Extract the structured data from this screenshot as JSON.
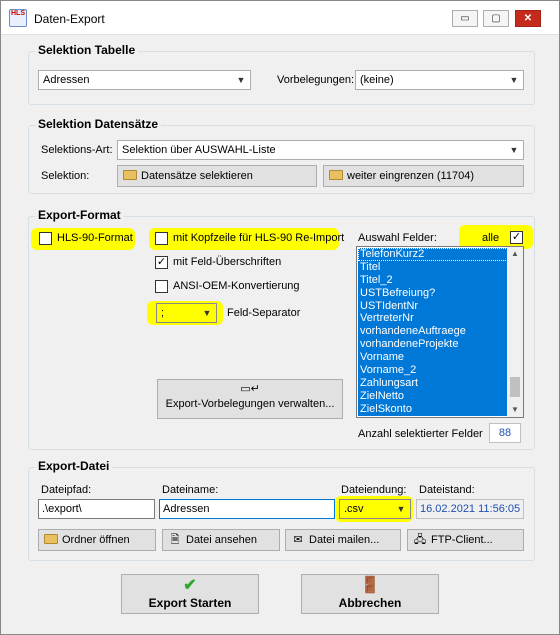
{
  "window": {
    "app_icon_text": "HLS",
    "title": "Daten-Export",
    "minimize": "▭",
    "maximize": "▢",
    "close": "✕"
  },
  "selektion_tabelle": {
    "title": "Selektion Tabelle",
    "table_value": "Adressen",
    "vorbelegungen_label": "Vorbelegungen:",
    "vorbelegungen_value": "(keine)"
  },
  "selektion_datensaetze": {
    "title": "Selektion Datensätze",
    "art_label": "Selektions-Art:",
    "art_value": "Selektion über AUSWAHL-Liste",
    "selektion_label": "Selektion:",
    "select_button": "Datensätze selektieren",
    "restrict_button": "weiter eingrenzen (11704)"
  },
  "export_format": {
    "title": "Export-Format",
    "hls90_label": "HLS-90-Format",
    "hls90_checked": false,
    "kopfzeile_label": "mit Kopfzeile für HLS-90 Re-Import",
    "kopfzeile_checked": false,
    "ueberschriften_label": "mit Feld-Überschriften",
    "ueberschriften_checked": true,
    "ansi_label": "ANSI-OEM-Konvertierung",
    "ansi_checked": false,
    "separator_value": ";",
    "separator_label": "Feld-Separator",
    "vorbelegungen_button": "Export-Vorbelegungen verwalten...",
    "auswahl_label": "Auswahl Felder:",
    "alle_label": "alle",
    "alle_checked": true,
    "fields": [
      "TelefonKurz2",
      "Titel",
      "Titel_2",
      "USTBefreiung?",
      "USTIdentNr",
      "VertreterNr",
      "vorhandeneAuftraege",
      "vorhandeneProjekte",
      "Vorname",
      "Vorname_2",
      "Zahlungsart",
      "ZielNetto",
      "ZielSkonto"
    ],
    "anzahl_label": "Anzahl selektierter Felder",
    "anzahl_value": "88"
  },
  "export_datei": {
    "title": "Export-Datei",
    "pfad_label": "Dateipfad:",
    "pfad_value": ".\\export\\",
    "name_label": "Dateiname:",
    "name_value": "Adressen",
    "endung_label": "Dateiendung:",
    "endung_value": ".csv",
    "stand_label": "Dateistand:",
    "stand_value": "16.02.2021 11:56:05",
    "ordner_button": "Ordner öffnen",
    "ansehen_button": "Datei ansehen",
    "mailen_button": "Datei mailen...",
    "ftp_button": "FTP-Client..."
  },
  "actions": {
    "start_label": "Export Starten",
    "start_icon": "✔",
    "cancel_label": "Abbrechen",
    "cancel_icon": "🚪"
  },
  "colors": {
    "highlight": "#ffff00",
    "selection": "#0078d7",
    "close_button": "#c42b1c",
    "date_text": "#1f4fb0"
  }
}
